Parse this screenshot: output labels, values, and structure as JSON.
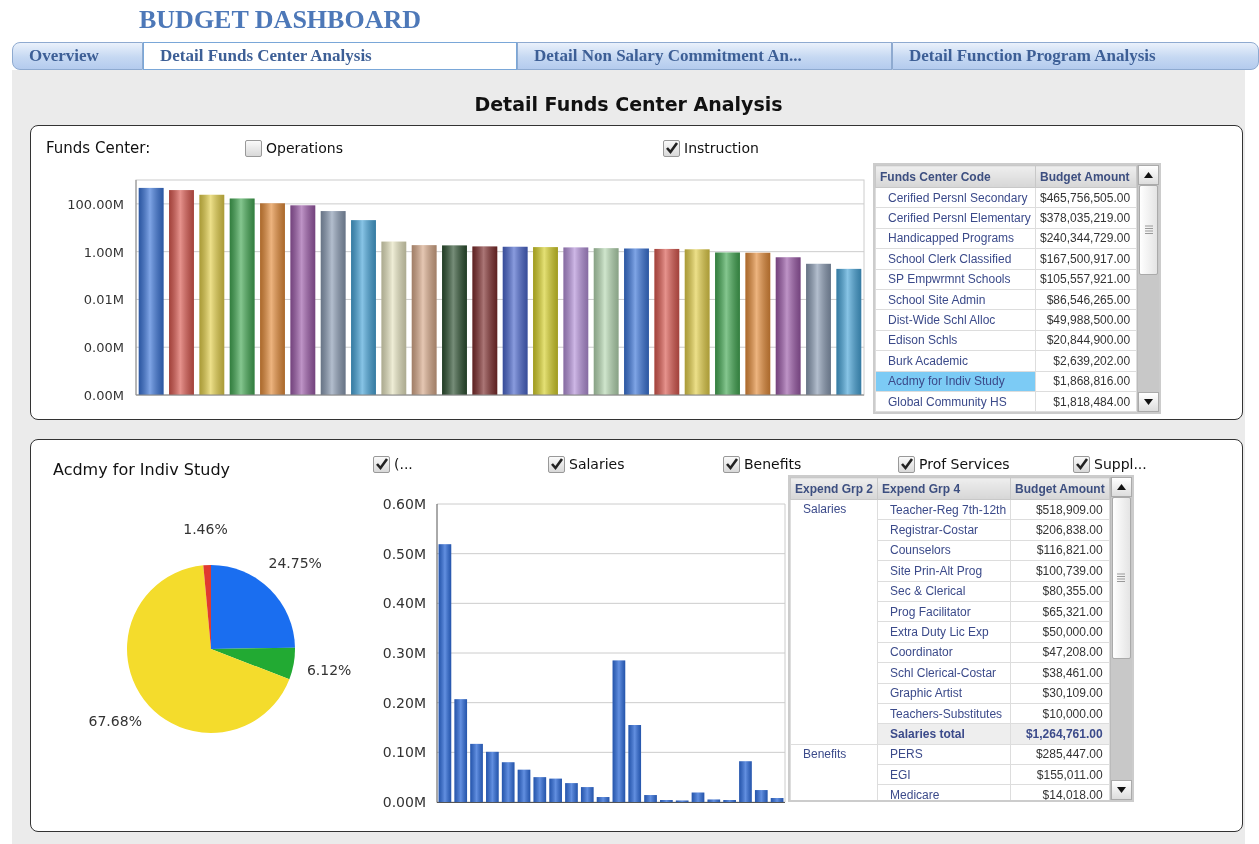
{
  "app_title": "BUDGET DASHBOARD",
  "tabs": [
    {
      "label": "Overview",
      "selected": false
    },
    {
      "label": "Detail Funds Center Analysis",
      "selected": true
    },
    {
      "label": "Detail Non Salary Commitment An...",
      "selected": false
    },
    {
      "label": "Detail Function Program Analysis",
      "selected": false
    }
  ],
  "page_heading": "Detail Funds Center Analysis",
  "funds_panel": {
    "label": "Funds Center:",
    "filters": [
      {
        "label": "Operations",
        "checked": false
      },
      {
        "label": "Instruction",
        "checked": true
      }
    ],
    "chart": {
      "axis_labels": [
        "100.00M",
        "1.00M",
        "0.01M",
        "0.00M",
        "0.00M"
      ]
    },
    "table": {
      "columns": [
        "Funds Center Code",
        "Budget Amount"
      ],
      "rows": [
        {
          "code": "Cerified Persnl Secondary",
          "amount": "$465,756,505.00",
          "selected": false
        },
        {
          "code": "Cerified Persnl Elementary",
          "amount": "$378,035,219.00",
          "selected": false
        },
        {
          "code": "Handicapped Programs",
          "amount": "$240,344,729.00",
          "selected": false
        },
        {
          "code": "School Clerk Classified",
          "amount": "$167,500,917.00",
          "selected": false
        },
        {
          "code": "SP Empwrmnt Schools",
          "amount": "$105,557,921.00",
          "selected": false
        },
        {
          "code": "School Site Admin",
          "amount": "$86,546,265.00",
          "selected": false
        },
        {
          "code": "Dist-Wide Schl Alloc",
          "amount": "$49,988,500.00",
          "selected": false
        },
        {
          "code": "Edison Schls",
          "amount": "$20,844,900.00",
          "selected": false
        },
        {
          "code": "Burk Academic",
          "amount": "$2,639,202.00",
          "selected": false
        },
        {
          "code": "Acdmy for Indiv Study",
          "amount": "$1,868,816.00",
          "selected": true
        },
        {
          "code": "Global Community HS",
          "amount": "$1,818,484.00",
          "selected": false
        }
      ]
    }
  },
  "detail_panel": {
    "title": "Acdmy for Indiv Study",
    "filters": [
      {
        "label": "(...",
        "checked": true
      },
      {
        "label": "Salaries",
        "checked": true
      },
      {
        "label": "Benefits",
        "checked": true
      },
      {
        "label": "Prof Services",
        "checked": true
      },
      {
        "label": "Suppl...",
        "checked": true
      }
    ],
    "pie": {
      "chart_data": {
        "type": "pie",
        "values": [
          24.75,
          6.12,
          67.68,
          1.46
        ],
        "colors": [
          "#1a6ef0",
          "#22aa33",
          "#f4dc2c",
          "#e03a30"
        ],
        "value_labels": [
          "24.75%",
          "6.12%",
          "67.68%",
          "1.46%"
        ]
      }
    },
    "bars": {
      "chart_data": {
        "type": "bar",
        "grid": true,
        "ylim": [
          0,
          0.6
        ],
        "yticks": [
          {
            "value": 0,
            "label": "0.00M"
          },
          {
            "value": 0.1,
            "label": "0.10M"
          },
          {
            "value": 0.2,
            "label": "0.20M"
          },
          {
            "value": 0.3,
            "label": "0.30M"
          },
          {
            "value": 0.4,
            "label": "0.40M"
          },
          {
            "value": 0.5,
            "label": "0.50M"
          },
          {
            "value": 0.6,
            "label": "0.60M"
          }
        ],
        "series": [
          {
            "color": "#2e6ad6",
            "values": [
              0.519,
              0.207,
              0.117,
              0.101,
              0.08,
              0.065,
              0.05,
              0.047,
              0.038,
              0.03,
              0.01,
              0.285,
              0.155,
              0.014,
              0.004,
              0.003,
              0.019,
              0.005,
              0.004,
              0.082,
              0.024,
              0.008
            ]
          }
        ]
      }
    },
    "table": {
      "columns": [
        "Expend Grp 2",
        "Expend Grp 4",
        "Budget Amount"
      ],
      "groups": [
        {
          "name": "Salaries",
          "rows": [
            {
              "item": "Teacher-Reg 7th-12th",
              "amount": "$518,909.00"
            },
            {
              "item": "Registrar-Costar",
              "amount": "$206,838.00"
            },
            {
              "item": "Counselors",
              "amount": "$116,821.00"
            },
            {
              "item": "Site Prin-Alt Prog",
              "amount": "$100,739.00"
            },
            {
              "item": "Sec & Clerical",
              "amount": "$80,355.00"
            },
            {
              "item": "Prog Facilitator",
              "amount": "$65,321.00"
            },
            {
              "item": "Extra Duty Lic Exp",
              "amount": "$50,000.00"
            },
            {
              "item": "Coordinator",
              "amount": "$47,208.00"
            },
            {
              "item": "Schl Clerical-Costar",
              "amount": "$38,461.00"
            },
            {
              "item": "Graphic Artist",
              "amount": "$30,109.00"
            },
            {
              "item": "Teachers-Substitutes",
              "amount": "$10,000.00"
            }
          ],
          "total": {
            "label": "Salaries total",
            "amount": "$1,264,761.00"
          }
        },
        {
          "name": "Benefits",
          "rows": [
            {
              "item": "PERS",
              "amount": "$285,447.00"
            },
            {
              "item": "EGI",
              "amount": "$155,011.00"
            },
            {
              "item": "Medicare",
              "amount": "$14,018.00"
            }
          ]
        }
      ]
    }
  }
}
